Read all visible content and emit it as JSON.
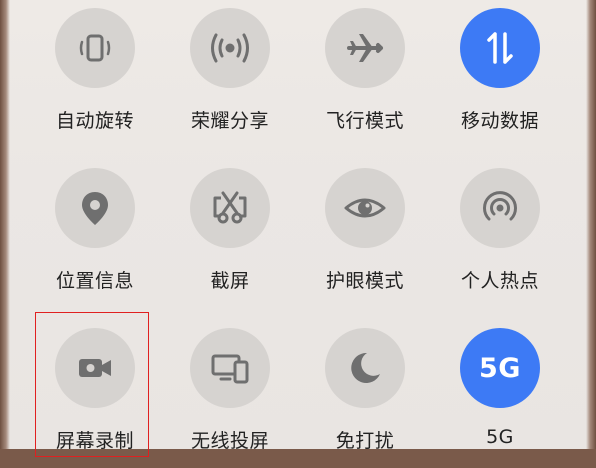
{
  "quick_settings": {
    "tiles": [
      {
        "label": "自动旋转",
        "icon": "auto-rotate-icon",
        "active": false
      },
      {
        "label": "荣耀分享",
        "icon": "share-broadcast-icon",
        "active": false
      },
      {
        "label": "飞行模式",
        "icon": "airplane-icon",
        "active": false
      },
      {
        "label": "移动数据",
        "icon": "mobile-data-arrows-icon",
        "active": true
      },
      {
        "label": "位置信息",
        "icon": "location-pin-icon",
        "active": false
      },
      {
        "label": "截屏",
        "icon": "screenshot-scissors-icon",
        "active": false
      },
      {
        "label": "护眼模式",
        "icon": "eye-icon",
        "active": false
      },
      {
        "label": "个人热点",
        "icon": "hotspot-icon",
        "active": false
      },
      {
        "label": "屏幕录制",
        "icon": "video-camera-icon",
        "active": false
      },
      {
        "label": "无线投屏",
        "icon": "screen-cast-icon",
        "active": false
      },
      {
        "label": "免打扰",
        "icon": "moon-icon",
        "active": false
      },
      {
        "label": "5G",
        "icon": "5g-badge-icon",
        "active": true,
        "badge_text": "5G"
      }
    ]
  },
  "colors": {
    "active": "#3d7af5",
    "inactive": "#d6d3d0",
    "icon_gray": "#6f6f6f",
    "highlight": "#e02020"
  }
}
